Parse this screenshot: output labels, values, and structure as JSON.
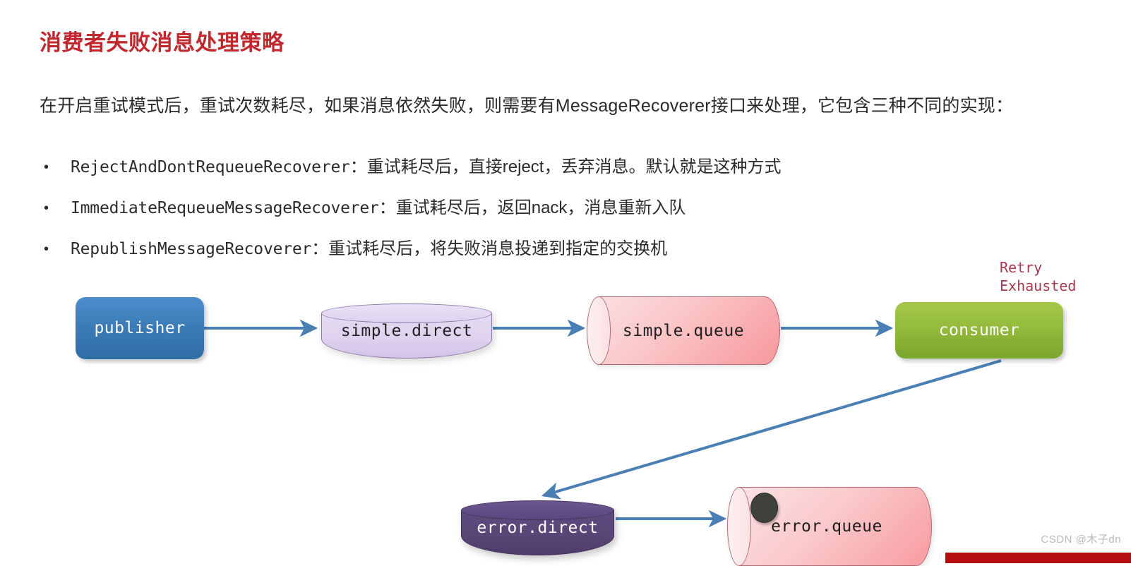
{
  "article": {
    "title": "消费者失败消息处理策略",
    "intro": "在开启重试模式后，重试次数耗尽，如果消息依然失败，则需要有MessageRecoverer接口来处理，它包含三种不同的实现：",
    "bullets": [
      {
        "marker": "•",
        "code": "RejectAndDontRequeueRecoverer",
        "text": "：重试耗尽后，直接reject，丢弃消息。默认就是这种方式"
      },
      {
        "marker": "•",
        "code": "ImmediateRequeueMessageRecoverer",
        "text": "：重试耗尽后，返回nack，消息重新入队"
      },
      {
        "marker": "•",
        "code": "RepublishMessageRecoverer",
        "text": "：重试耗尽后，将失败消息投递到指定的交换机"
      }
    ]
  },
  "diagram": {
    "nodes": {
      "publisher": "publisher",
      "simple_direct": "simple.direct",
      "simple_queue": "simple.queue",
      "consumer": "consumer",
      "error_direct": "error.direct",
      "error_queue": "error.queue"
    },
    "annotation": "Retry\nExhausted",
    "colors": {
      "publisher_fill": "#3b7cb8",
      "simple_direct_fill": "#ded2ef",
      "simple_queue_fill": "#fac6c8",
      "consumer_fill": "#94bb3c",
      "error_direct_fill": "#594677",
      "error_queue_fill": "#fac9cb",
      "arrow": "#4a7fb5",
      "annotation_text": "#a73a4e",
      "title_text": "#c0282d"
    },
    "edges": [
      {
        "from": "publisher",
        "to": "simple.direct"
      },
      {
        "from": "simple.direct",
        "to": "simple.queue"
      },
      {
        "from": "simple.queue",
        "to": "consumer"
      },
      {
        "from": "consumer",
        "to": "error.direct"
      },
      {
        "from": "error.direct",
        "to": "error.queue"
      }
    ]
  },
  "watermark": "CSDN @木子dn"
}
